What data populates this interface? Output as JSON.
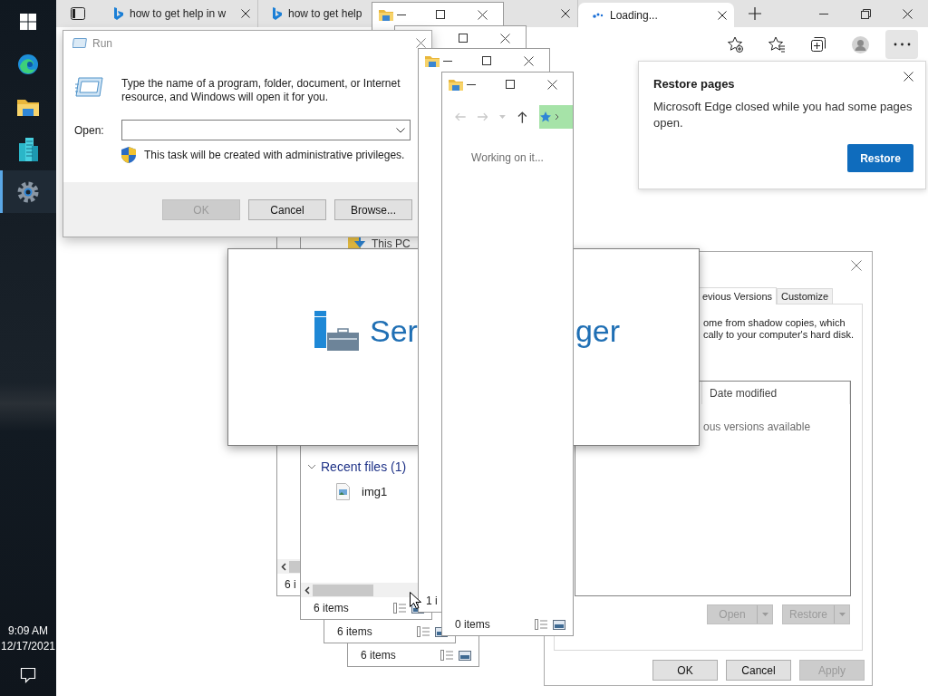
{
  "taskbar": {
    "items": [
      {
        "kind": "start",
        "selected": false
      },
      {
        "kind": "edge",
        "selected": false
      },
      {
        "kind": "explorer",
        "selected": false
      },
      {
        "kind": "server_manager",
        "selected": false
      },
      {
        "kind": "settings",
        "selected": true
      }
    ],
    "time": "9:09 AM",
    "date": "12/17/2021"
  },
  "browser": {
    "tabs": [
      {
        "kind": "page",
        "title": "how to get help in w",
        "selected": false
      },
      {
        "kind": "page",
        "title": "how to get help",
        "selected": false
      },
      {
        "kind": "covered",
        "selected": false
      },
      {
        "kind": "loading",
        "title": "Loading...",
        "selected": true
      }
    ]
  },
  "restore_popup": {
    "title": "Restore pages",
    "message": "Microsoft Edge closed while you had some pages open.",
    "button": "Restore"
  },
  "explorer_windows": [
    {
      "kind": "explorer"
    },
    {
      "kind": "explorer"
    },
    {
      "kind": "explorer",
      "status": "6 items"
    },
    {
      "kind": "explorer",
      "status": "6 items"
    },
    {
      "kind": "explorer",
      "status": "6 i"
    },
    {
      "kind": "explorer",
      "nav_item": "This PC",
      "section": {
        "title": "Recent files (1)",
        "expanded": true,
        "files": [
          "img1"
        ]
      },
      "status": "6 items"
    },
    {
      "kind": "explorer",
      "status": "1 i"
    },
    {
      "kind": "explorer",
      "message": "Working on it...",
      "status": "0 items"
    }
  ],
  "run_dialog": {
    "title": "Run",
    "description": "Type the name of a program, folder, document, or Internet resource, and Windows will open it for you.",
    "open_label": "Open:",
    "admin_note": "This task will be created with administrative privileges.",
    "buttons": [
      {
        "label": "OK",
        "disabled": true
      },
      {
        "label": "Cancel",
        "disabled": false
      },
      {
        "label": "Browse...",
        "disabled": false
      }
    ]
  },
  "splash": {
    "text_parts": [
      "Ser",
      "ger"
    ]
  },
  "properties_dialog": {
    "tabs": [
      {
        "label": "evious Versions",
        "selected": true
      },
      {
        "label": "Customize",
        "selected": false
      }
    ],
    "description_lines": [
      "ome from shadow copies, which",
      "cally to your computer's hard disk."
    ],
    "column": "Date modified",
    "empty_message": "ous versions available",
    "actions": [
      {
        "label": "Open",
        "disabled": true
      },
      {
        "label": "Restore",
        "disabled": true
      }
    ],
    "buttons": [
      {
        "label": "OK",
        "disabled": false
      },
      {
        "label": "Cancel",
        "disabled": false
      },
      {
        "label": "Apply",
        "disabled": true
      }
    ]
  }
}
